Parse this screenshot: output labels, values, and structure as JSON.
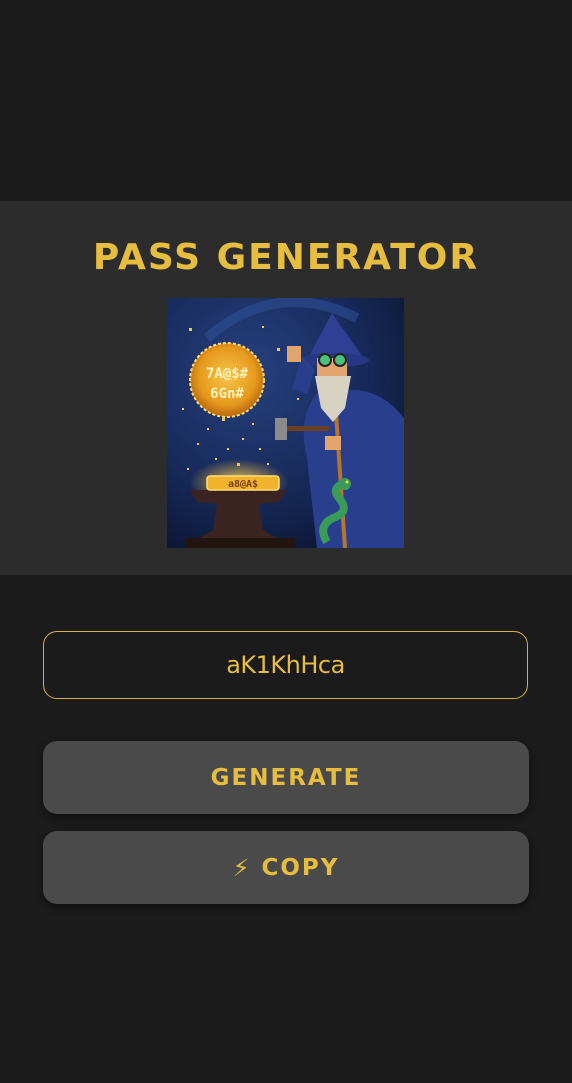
{
  "app": {
    "title": "PASS GENERATOR"
  },
  "password": {
    "value": "aK1KhHca"
  },
  "buttons": {
    "generate_label": "GENERATE",
    "copy_icon": "⚡",
    "copy_label": "COPY"
  },
  "colors": {
    "background": "#1b1b1b",
    "hero_background": "#2c2c2c",
    "accent": "#e6bd3e",
    "button_background": "#4a4a4a"
  },
  "hero_image": {
    "subject": "pixel-art wizard forging a password on an anvil",
    "bubble_text_line1": "7A@$#",
    "bubble_text_line2": "6Gn#",
    "ingot_text": "a8@A$"
  }
}
